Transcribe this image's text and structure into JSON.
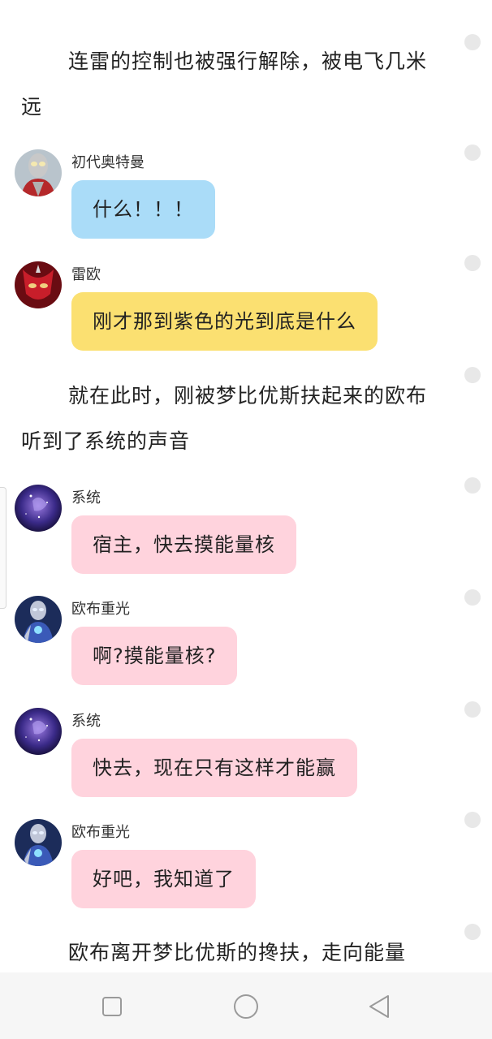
{
  "narration": [
    "连雷的控制也被强行解除，被电飞几米远",
    "就在此时，刚被梦比优斯扶起来的欧布听到了系统的声音",
    "欧布离开梦比优斯的搀扶，走向能量"
  ],
  "messages": [
    {
      "name": "初代奥特曼",
      "text": "什么！！！",
      "color": "#aadcf8",
      "avatar": "ultraman-avatar"
    },
    {
      "name": "雷欧",
      "text": "刚才那到紫色的光到底是什么",
      "color": "#fbe071",
      "avatar": "leo-avatar"
    },
    {
      "name": "系统",
      "text": "宿主，快去摸能量核",
      "color": "#ffd3dd",
      "avatar": "system-avatar"
    },
    {
      "name": "欧布重光",
      "text": "啊?摸能量核?",
      "color": "#ffd3dd",
      "avatar": "orb-avatar"
    },
    {
      "name": "系统",
      "text": "快去，现在只有这样才能赢",
      "color": "#ffd3dd",
      "avatar": "system-avatar"
    },
    {
      "name": "欧布重光",
      "text": "好吧，我知道了",
      "color": "#ffd3dd",
      "avatar": "orb-avatar"
    }
  ],
  "navbar": {
    "icons": [
      "square-recent-icon",
      "circle-home-icon",
      "triangle-back-icon"
    ]
  }
}
